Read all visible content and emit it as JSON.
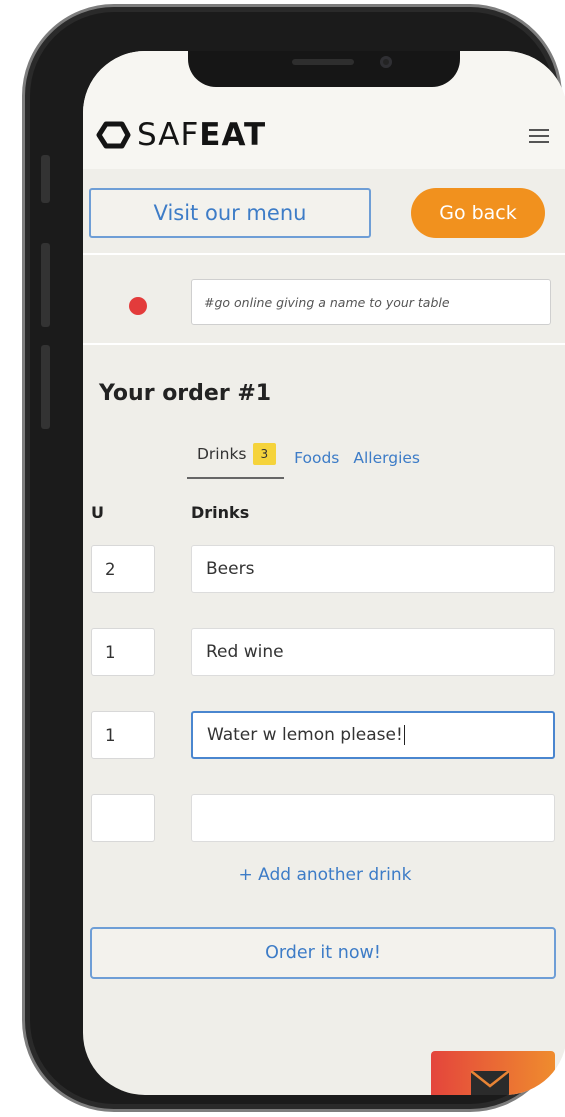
{
  "header": {
    "logo_light": "SAF",
    "logo_bold": "EAT"
  },
  "nav": {
    "visit_menu_label": "Visit our menu",
    "go_back_label": "Go back"
  },
  "table": {
    "status_color": "#e33b3b",
    "name_placeholder": "#go online giving a name to your table"
  },
  "order": {
    "title": "Your order #1",
    "tabs": [
      {
        "label": "Drinks",
        "badge": "3",
        "active": true
      },
      {
        "label": "Foods"
      },
      {
        "label": "Allergies"
      }
    ],
    "columns": {
      "units": "U",
      "item": "Drinks"
    },
    "rows": [
      {
        "qty": "2",
        "item": "Beers"
      },
      {
        "qty": "1",
        "item": "Red wine"
      },
      {
        "qty": "1",
        "item": "Water w lemon please!"
      },
      {
        "qty": "",
        "item": ""
      }
    ],
    "add_label": "+ Add another drink",
    "submit_label": "Order it now!"
  },
  "colors": {
    "accent_blue": "#3d7cc7",
    "accent_orange": "#f1911e",
    "badge_yellow": "#f5d33b",
    "background": "#efeee9"
  },
  "icons": {
    "logo": "safeat-logo-icon",
    "menu": "hamburger-menu-icon",
    "mail": "mail-icon"
  }
}
